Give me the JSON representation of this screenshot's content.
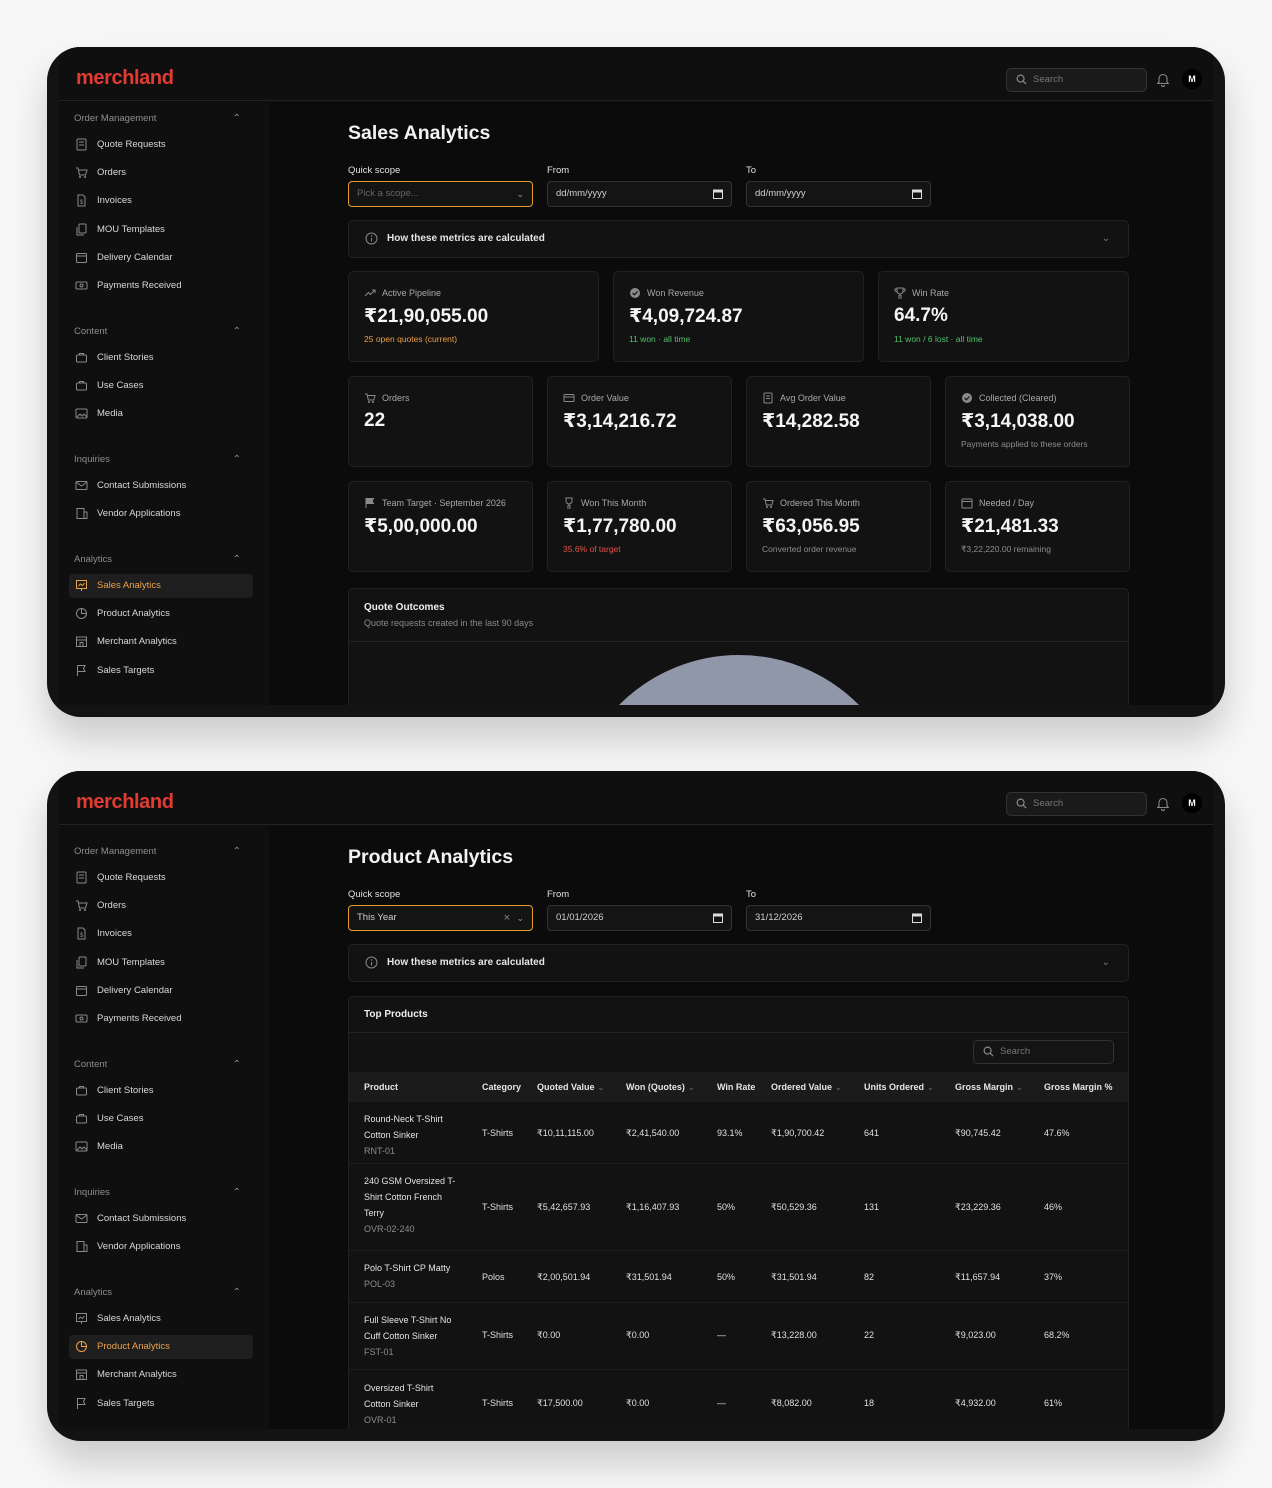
{
  "app": {
    "logo": "merchland",
    "search_placeholder": "Search",
    "avatar_initial": "M"
  },
  "sidebar": {
    "sections": [
      {
        "title": "Order Management",
        "items": [
          "Quote Requests",
          "Orders",
          "Invoices",
          "MOU Templates",
          "Delivery Calendar",
          "Payments Received"
        ]
      },
      {
        "title": "Content",
        "items": [
          "Client Stories",
          "Use Cases",
          "Media"
        ]
      },
      {
        "title": "Inquiries",
        "items": [
          "Contact Submissions",
          "Vendor Applications"
        ]
      },
      {
        "title": "Analytics",
        "items": [
          "Sales Analytics",
          "Product Analytics",
          "Merchant Analytics",
          "Sales Targets"
        ]
      }
    ]
  },
  "sales": {
    "title": "Sales Analytics",
    "filters": {
      "scope_label": "Quick scope",
      "scope_placeholder": "Pick a scope...",
      "from_label": "From",
      "from_value": "dd/mm/yyyy",
      "to_label": "To",
      "to_value": "dd/mm/yyyy"
    },
    "accordion": "How these metrics are calculated",
    "cards_row1": [
      {
        "label": "Active Pipeline",
        "value": "₹21,90,055.00",
        "sub": "25 open quotes (current)",
        "icon": "trending-up-icon"
      },
      {
        "label": "Won Revenue",
        "value": "₹4,09,724.87",
        "sub": "11 won · all time",
        "icon": "check-circle-icon"
      },
      {
        "label": "Win Rate",
        "value": "64.7%",
        "sub": "11 won / 6 lost · all time",
        "icon": "trophy-icon"
      }
    ],
    "cards_row2": [
      {
        "label": "Orders",
        "value": "22",
        "sub": "",
        "icon": "cart-icon"
      },
      {
        "label": "Order Value",
        "value": "₹3,14,216.72",
        "sub": "",
        "icon": "receipt-icon"
      },
      {
        "label": "Avg Order Value",
        "value": "₹14,282.58",
        "sub": "",
        "icon": "document-icon"
      },
      {
        "label": "Collected (Cleared)",
        "value": "₹3,14,038.00",
        "sub": "Payments applied to these orders",
        "icon": "check-circle-icon"
      }
    ],
    "cards_row3": [
      {
        "label": "Team Target · September 2026",
        "value": "₹5,00,000.00",
        "sub": "",
        "icon": "flag-icon"
      },
      {
        "label": "Won This Month",
        "value": "₹1,77,780.00",
        "sub": "35.6% of target",
        "icon": "trophy-icon"
      },
      {
        "label": "Ordered This Month",
        "value": "₹63,056.95",
        "sub": "Converted order revenue",
        "icon": "cart-icon"
      },
      {
        "label": "Needed / Day",
        "value": "₹21,481.33",
        "sub": "₹3,22,220.00 remaining",
        "icon": "calendar-icon"
      }
    ],
    "quote_outcomes": {
      "title": "Quote Outcomes",
      "subtitle": "Quote requests created in the last 90 days"
    },
    "chart_data": {
      "type": "pie",
      "title": "Quote Outcomes",
      "series": [
        {
          "values": [
            50,
            50
          ]
        }
      ],
      "colors": [
        "#8f97a8",
        "#45b956"
      ],
      "note": "partially visible donut/pie, top portion only"
    }
  },
  "product": {
    "title": "Product Analytics",
    "filters": {
      "scope_label": "Quick scope",
      "scope_value": "This Year",
      "from_label": "From",
      "from_value": "01/01/2026",
      "to_label": "To",
      "to_value": "31/12/2026"
    },
    "accordion": "How these metrics are calculated",
    "table": {
      "title": "Top Products",
      "search_placeholder": "Search",
      "columns": [
        "Product",
        "Category",
        "Quoted Value",
        "Won (Quotes)",
        "Win Rate",
        "Ordered Value",
        "Units Ordered",
        "Gross Margin",
        "Gross Margin %"
      ],
      "rows": [
        {
          "name": [
            "Round-Neck T-Shirt",
            "Cotton Sinker"
          ],
          "code": "RNT-01",
          "category": "T-Shirts",
          "quoted": "₹10,11,115.00",
          "won": "₹2,41,540.00",
          "win_rate": "93.1%",
          "ordered": "₹1,90,700.42",
          "units": "641",
          "margin": "₹90,745.42",
          "margin_pct": "47.6%"
        },
        {
          "name": [
            "240 GSM Oversized T-",
            "Shirt Cotton French",
            "Terry"
          ],
          "code": "OVR-02-240",
          "category": "T-Shirts",
          "quoted": "₹5,42,657.93",
          "won": "₹1,16,407.93",
          "win_rate": "50%",
          "ordered": "₹50,529.36",
          "units": "131",
          "margin": "₹23,229.36",
          "margin_pct": "46%"
        },
        {
          "name": [
            "Polo T-Shirt CP Matty"
          ],
          "code": "POL-03",
          "category": "Polos",
          "quoted": "₹2,00,501.94",
          "won": "₹31,501.94",
          "win_rate": "50%",
          "ordered": "₹31,501.94",
          "units": "82",
          "margin": "₹11,657.94",
          "margin_pct": "37%"
        },
        {
          "name": [
            "Full Sleeve T-Shirt No",
            "Cuff Cotton Sinker"
          ],
          "code": "FST-01",
          "category": "T-Shirts",
          "quoted": "₹0.00",
          "won": "₹0.00",
          "win_rate": "—",
          "ordered": "₹13,228.00",
          "units": "22",
          "margin": "₹9,023.00",
          "margin_pct": "68.2%"
        },
        {
          "name": [
            "Oversized T-Shirt",
            "Cotton Sinker"
          ],
          "code": "OVR-01",
          "category": "T-Shirts",
          "quoted": "₹17,500.00",
          "won": "₹0.00",
          "win_rate": "—",
          "ordered": "₹8,082.00",
          "units": "18",
          "margin": "₹4,932.00",
          "margin_pct": "61%"
        }
      ]
    }
  }
}
